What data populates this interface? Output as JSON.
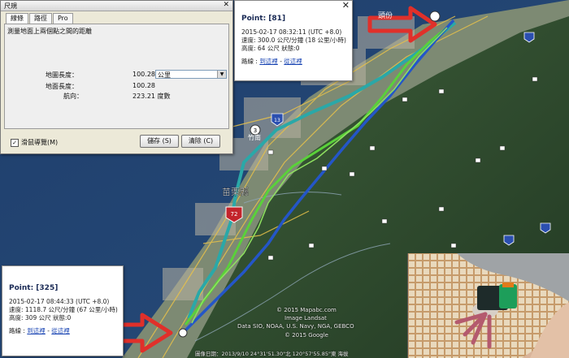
{
  "ruler_window": {
    "title": "尺規",
    "tabs": [
      "線條",
      "路徑",
      "Pro"
    ],
    "description": "測量地面上兩個點之間的距離",
    "rows": [
      {
        "label": "地圖長度：",
        "value": "100.28"
      },
      {
        "label": "地面長度：",
        "value": "100.28"
      },
      {
        "label": "航向：",
        "value": "223.21 度數"
      }
    ],
    "unit_select": "公里",
    "mouse_nav_label": "滑鼠導覽(M)",
    "mouse_nav_checked": true,
    "save_button": "儲存 (S)",
    "clear_button": "清除 (C)"
  },
  "info_top": {
    "title": "Point: [81]",
    "line1": "2015-02-17 08:32:11 (UTC +8.0)",
    "line2": "速度: 300.0 公尺/分鐘 (18 公里/小時)",
    "line3": "高度: 64 公尺 狀態:0",
    "links_prefix": "路線 :",
    "link1": "到這裡",
    "link_sep": " - ",
    "link2": "從這裡"
  },
  "info_bottom": {
    "title": "Point: [325]",
    "line1": "2015-02-17 08:44:33 (UTC +8.0)",
    "line2": "速度: 1118.7 公尺/分鐘 (67 公里/小時)",
    "line3": "高度: 309 公尺 狀態:0",
    "links_prefix": "路線 :",
    "link1": "到這裡",
    "link_sep": " - ",
    "link2": "從這裡"
  },
  "map_labels": {
    "county": "苗栗縣",
    "town1": "竹南",
    "town2": "頭份",
    "road_marker": "72",
    "shield1": "3",
    "shield2": "13"
  },
  "attribution": {
    "line1": "© 2015 Mapabc.com",
    "line2": "Image Landsat",
    "line3": "Data SIO, NOAA, U.S. Navy, NGA, GEBCO",
    "line4": "© 2015 Google",
    "status": "圖像日期：2013/9/10    24°31'51.30\"北 120°57'55.85\"東  海拔"
  },
  "colors": {
    "track_green": "#5ad13a",
    "track_teal": "#2aa8a8",
    "track_blue": "#2456c8",
    "arrow_red": "#e0302a"
  }
}
